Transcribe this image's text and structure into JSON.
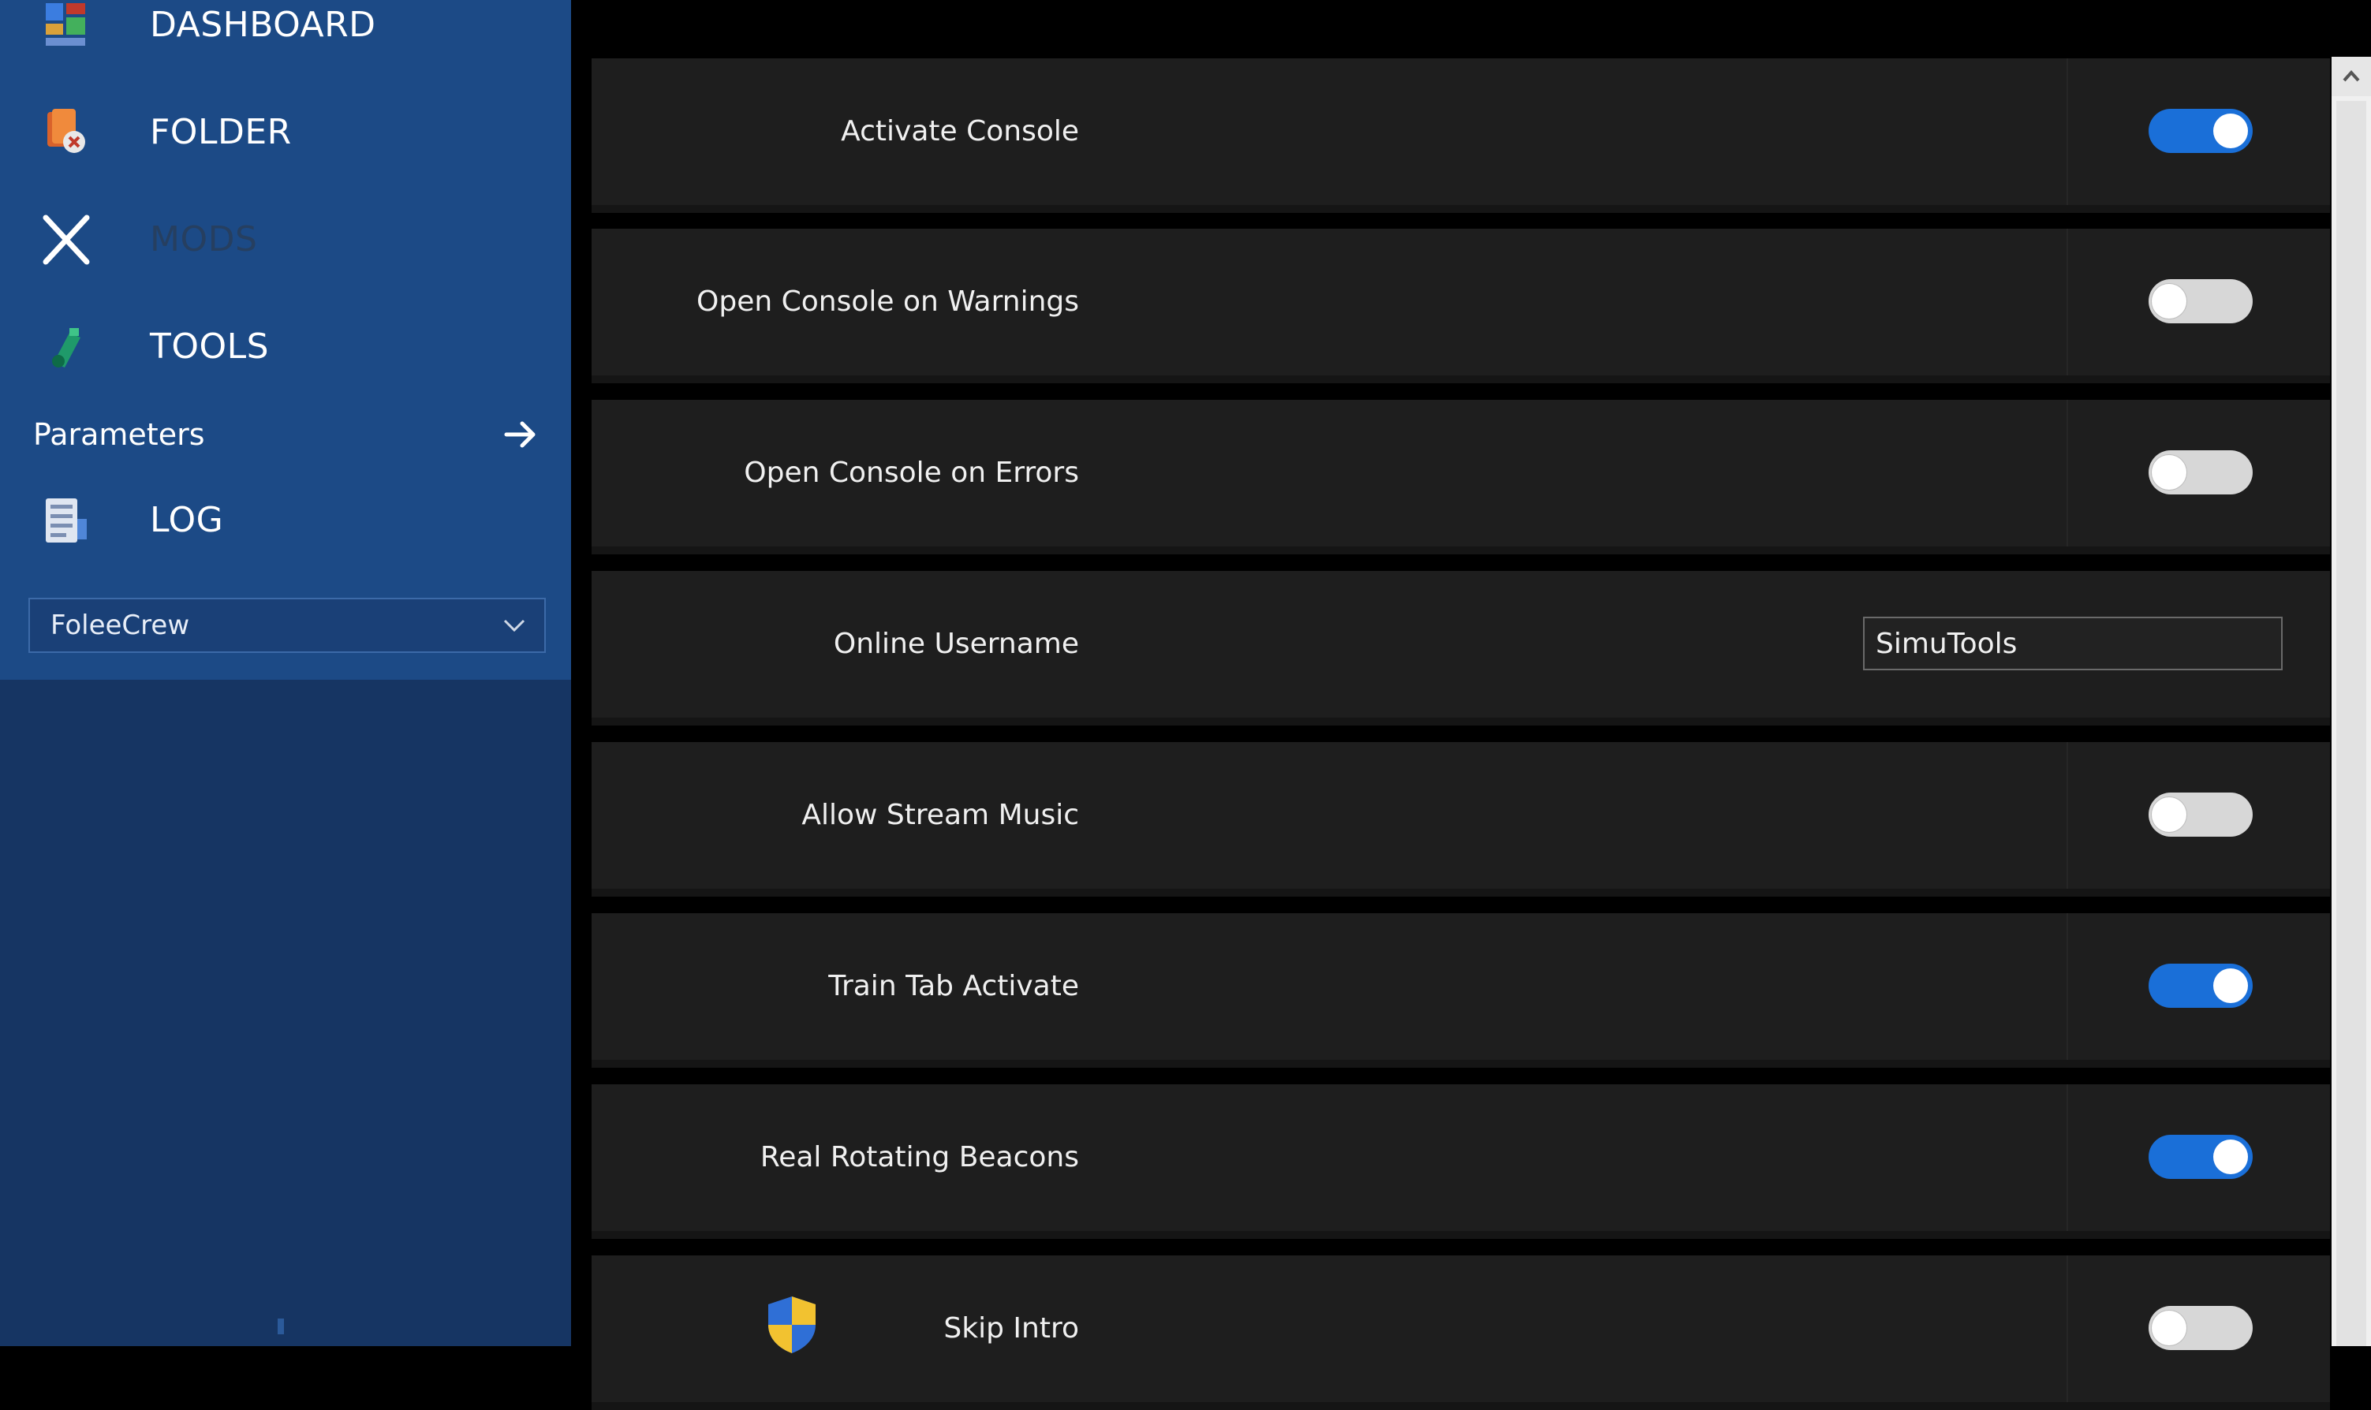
{
  "sidebar": {
    "nav_items": [
      {
        "label": "DASHBOARD",
        "icon": "dashboard-icon"
      },
      {
        "label": "FOLDER",
        "icon": "folder-icon"
      },
      {
        "label": "MODS",
        "icon": "mods-x-icon"
      },
      {
        "label": "TOOLS",
        "icon": "tools-icon"
      }
    ],
    "parameters_label": "Parameters",
    "log_label": "LOG",
    "profile_select": {
      "selected": "FoleeCrew"
    }
  },
  "settings": {
    "activate_console": {
      "label": "Activate Console",
      "enabled": true
    },
    "open_console_warnings": {
      "label": "Open Console on Warnings",
      "enabled": false
    },
    "open_console_errors": {
      "label": "Open Console on Errors",
      "enabled": false
    },
    "online_username": {
      "label": "Online Username",
      "value": "SimuTools"
    },
    "allow_stream_music": {
      "label": "Allow Stream Music",
      "enabled": false
    },
    "train_tab_activate": {
      "label": "Train Tab Activate",
      "enabled": true
    },
    "real_rotating_beacons": {
      "label": "Real Rotating Beacons",
      "enabled": true
    },
    "skip_intro": {
      "label": "Skip Intro",
      "enabled": false
    }
  },
  "colors": {
    "sidebar_top": "#1c4a86",
    "sidebar_bottom": "#163563",
    "row_bg": "#1e1e1e",
    "toggle_on": "#1a6fd8",
    "toggle_off": "#d7d7d7"
  }
}
